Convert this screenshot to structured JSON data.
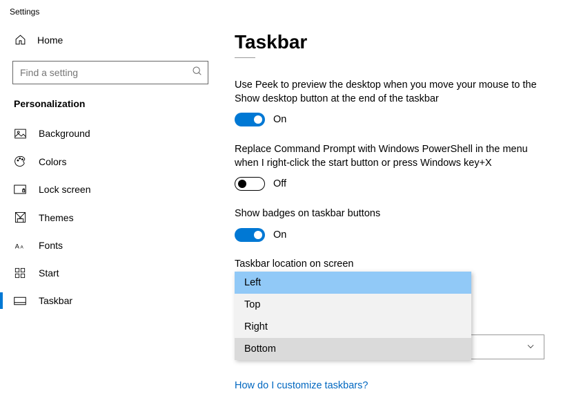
{
  "window_title": "Settings",
  "home_label": "Home",
  "search": {
    "placeholder": "Find a setting"
  },
  "section_title": "Personalization",
  "nav": [
    {
      "key": "background",
      "label": "Background"
    },
    {
      "key": "colors",
      "label": "Colors"
    },
    {
      "key": "lockscreen",
      "label": "Lock screen"
    },
    {
      "key": "themes",
      "label": "Themes"
    },
    {
      "key": "fonts",
      "label": "Fonts"
    },
    {
      "key": "start",
      "label": "Start"
    },
    {
      "key": "taskbar",
      "label": "Taskbar"
    }
  ],
  "page_title": "Taskbar",
  "settings": {
    "peek": {
      "desc": "Use Peek to preview the desktop when you move your mouse to the Show desktop button at the end of the taskbar",
      "state_label": "On",
      "on": true
    },
    "powershell": {
      "desc": "Replace Command Prompt with Windows PowerShell in the menu when I right-click the start button or press Windows key+X",
      "state_label": "Off",
      "on": false
    },
    "badges": {
      "desc": "Show badges on taskbar buttons",
      "state_label": "On",
      "on": true
    },
    "location": {
      "label": "Taskbar location on screen",
      "options": [
        "Left",
        "Top",
        "Right",
        "Bottom"
      ],
      "highlighted": "Left",
      "hovered": "Bottom"
    }
  },
  "help_link": "How do I customize taskbars?"
}
